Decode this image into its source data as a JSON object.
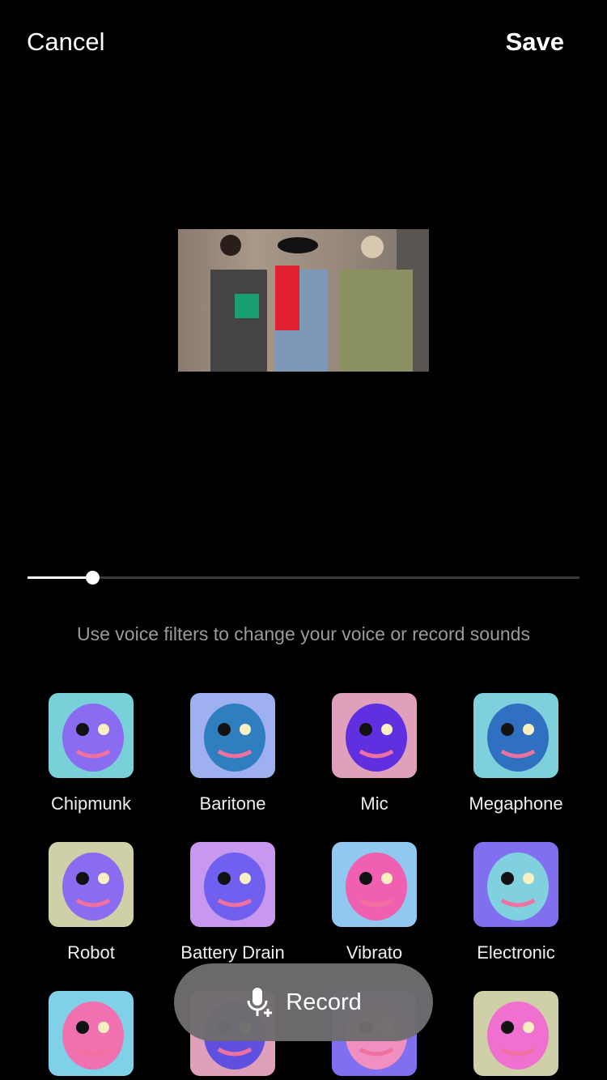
{
  "header": {
    "cancel_label": "Cancel",
    "save_label": "Save"
  },
  "playback": {
    "progress": 0.117
  },
  "hint": "Use voice filters to change your voice or record sounds",
  "filters": [
    {
      "label": "Chipmunk",
      "bg": "#7ad0d8",
      "fg": "#8a6cf0",
      "icon": "chipmunk-icon"
    },
    {
      "label": "Baritone",
      "bg": "#9fb0f0",
      "fg": "#2f7fc0",
      "icon": "baritone-face-icon"
    },
    {
      "label": "Mic",
      "bg": "#e0a0bc",
      "fg": "#6030e0",
      "icon": "mic-icon"
    },
    {
      "label": "Megaphone",
      "bg": "#7ed0dc",
      "fg": "#2f70c0",
      "icon": "megaphone-icon"
    },
    {
      "label": "Robot",
      "bg": "#d0d0a8",
      "fg": "#8a6cf0",
      "icon": "robot-icon"
    },
    {
      "label": "Battery Drain",
      "bg": "#c898f0",
      "fg": "#7060f0",
      "icon": "battery-icon"
    },
    {
      "label": "Vibrato",
      "bg": "#90c8f0",
      "fg": "#f060b0",
      "icon": "lightning-icon"
    },
    {
      "label": "Electronic",
      "bg": "#8070f0",
      "fg": "#80d0e0",
      "icon": "chip-icon"
    },
    {
      "label": "",
      "bg": "#80d0e8",
      "fg": "#f070b0",
      "icon": "mouth-icon"
    },
    {
      "label": "",
      "bg": "#e0a0bc",
      "fg": "#6050e0",
      "icon": "keys-icon"
    },
    {
      "label": "",
      "bg": "#8070f0",
      "fg": "#f090c0",
      "icon": "face-icon"
    },
    {
      "label": "",
      "bg": "#d0d0a8",
      "fg": "#f070d0",
      "icon": "pink-creature-icon"
    }
  ],
  "record": {
    "label": "Record"
  }
}
